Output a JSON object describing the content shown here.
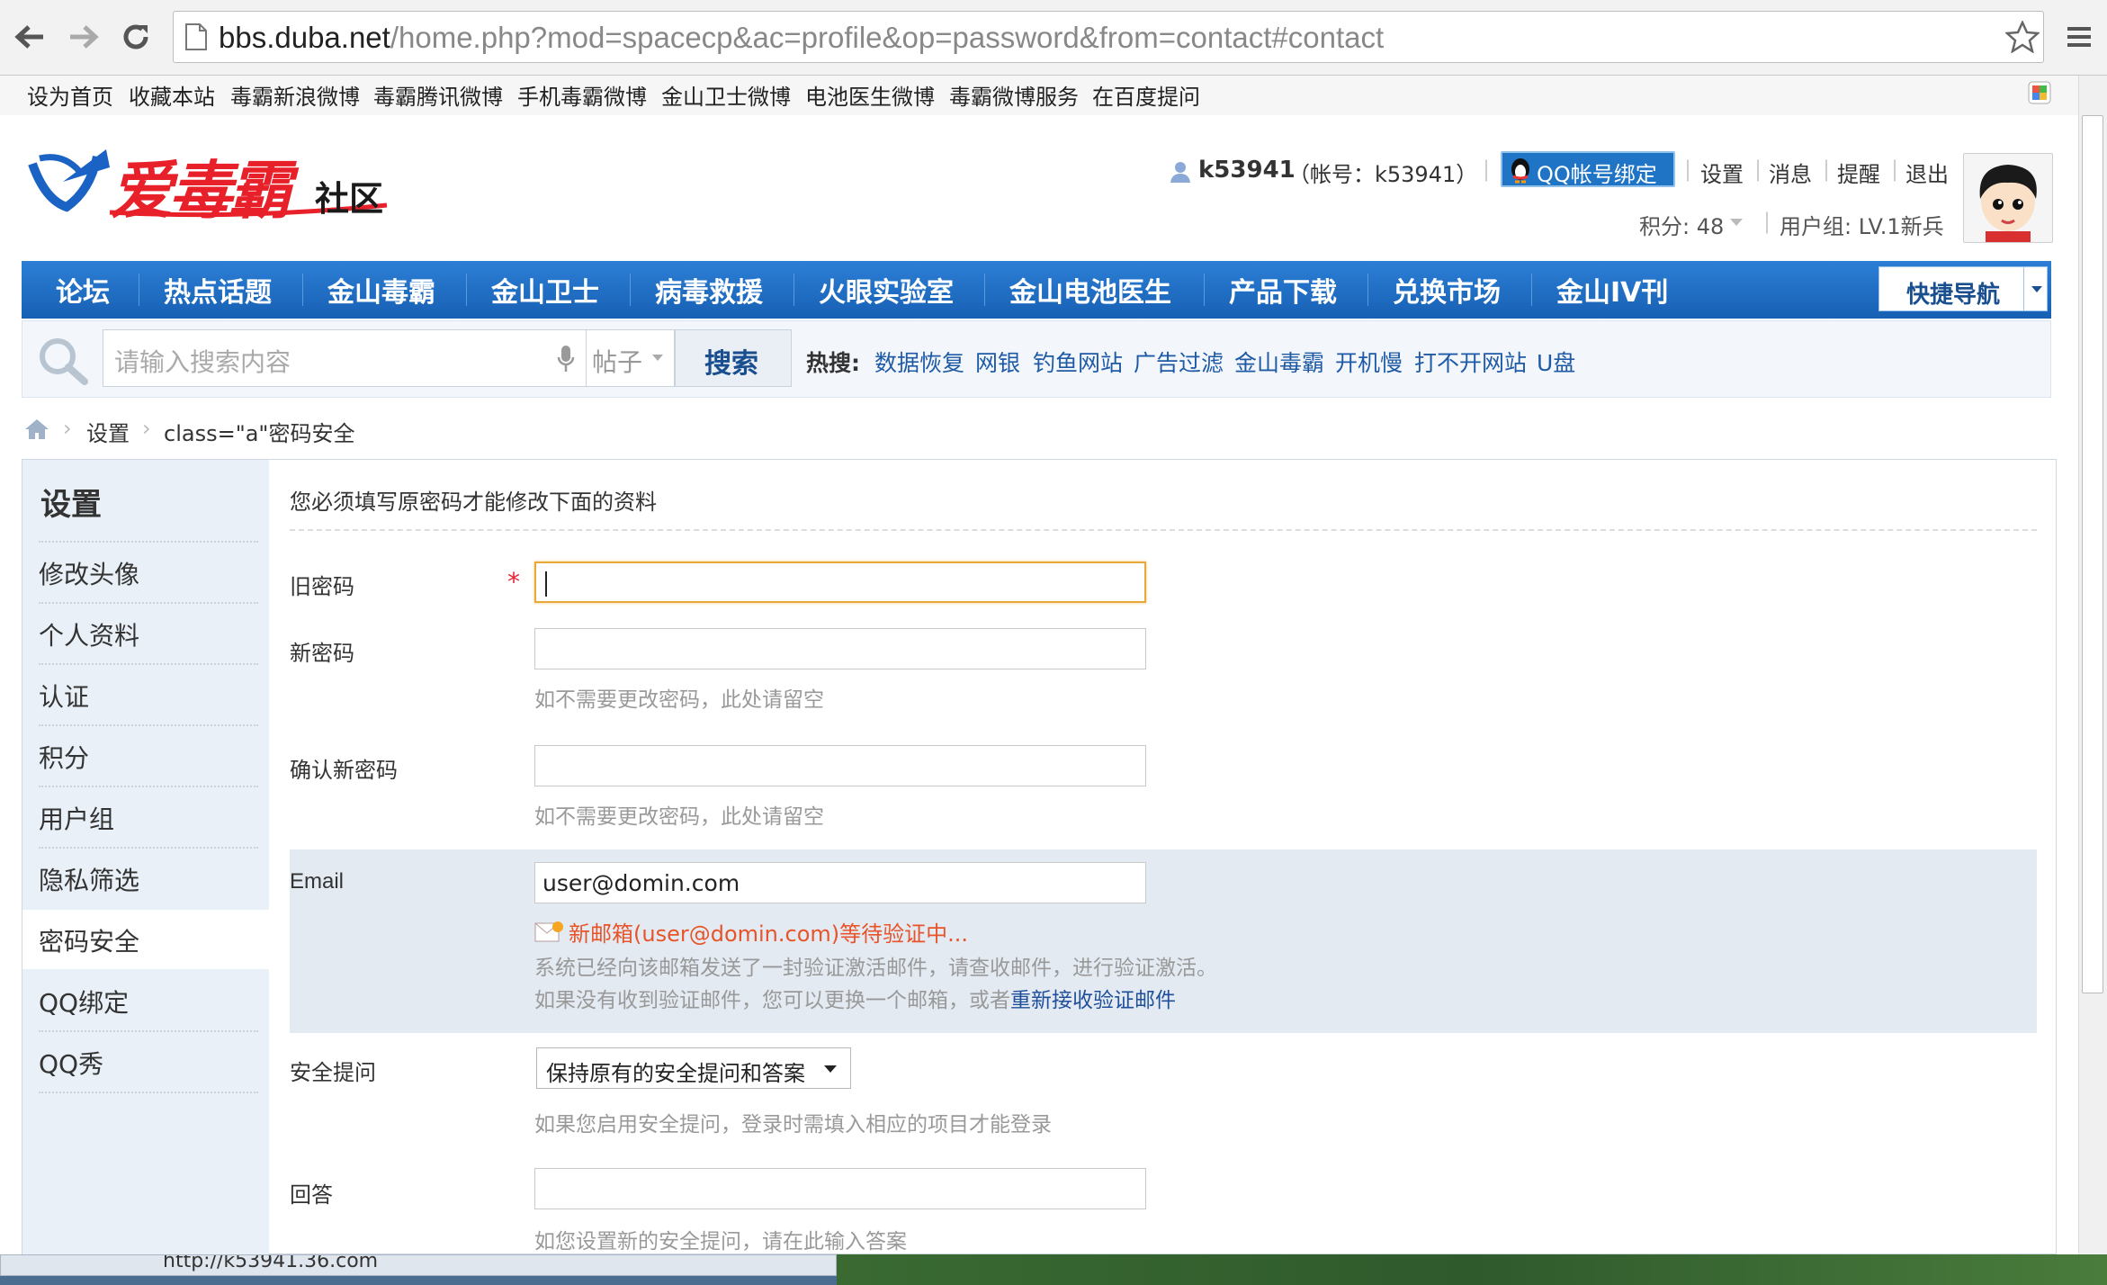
{
  "browser": {
    "url_host": "bbs.duba.net",
    "url_path": "/home.php?mod=spacecp&ac=profile&op=password&from=contact#contact"
  },
  "bookmarks": [
    "设为首页",
    "收藏本站",
    "毒霸新浪微博",
    "毒霸腾讯微博",
    "手机毒霸微博",
    "金山卫士微博",
    "电池医生微博",
    "毒霸微博服务",
    "在百度提问"
  ],
  "logo": {
    "main": "爱毒霸",
    "sub": "社区"
  },
  "user": {
    "name": "k53941",
    "account": "（帐号：k53941）",
    "qq_bind": "QQ帐号绑定",
    "links": [
      "设置",
      "消息",
      "提醒",
      "退出"
    ],
    "points": "积分: 48",
    "group": "用户组: LV.1新兵"
  },
  "nav": {
    "items": [
      "论坛",
      "热点话题",
      "金山毒霸",
      "金山卫士",
      "病毒救援",
      "火眼实验室",
      "金山电池医生",
      "产品下载",
      "兑换市场",
      "金山IV刊"
    ],
    "quick": "快捷导航"
  },
  "search": {
    "placeholder": "请输入搜索内容",
    "type": "帖子",
    "button": "搜索",
    "hot_label": "热搜:",
    "hot": [
      "数据恢复",
      "网银",
      "钓鱼网站",
      "广告过滤",
      "金山毒霸",
      "开机慢",
      "打不开网站",
      "U盘"
    ]
  },
  "breadcrumb": [
    "设置",
    "class=\"a\"密码安全"
  ],
  "sidebar": {
    "title": "设置",
    "items": [
      "修改头像",
      "个人资料",
      "认证",
      "积分",
      "用户组",
      "隐私筛选",
      "密码安全",
      "QQ绑定",
      "QQ秀"
    ]
  },
  "form": {
    "note": "您必须填写原密码才能修改下面的资料",
    "old_password": "旧密码",
    "required": "*",
    "new_password": "新密码",
    "new_hint": "如不需要更改密码，此处请留空",
    "confirm_password": "确认新密码",
    "confirm_hint": "如不需要更改密码，此处请留空",
    "email_label": "Email",
    "email_value": "user@domin.com",
    "email_pending": "新邮箱(user@domin.com)等待验证中...",
    "email_info1": "系统已经向该邮箱发送了一封验证激活邮件，请查收邮件，进行验证激活。",
    "email_info2": "如果没有收到验证邮件，您可以更换一个邮箱，或者",
    "email_resend": "重新接收验证邮件",
    "security_label": "安全提问",
    "security_value": "保持原有的安全提问和答案",
    "security_hint": "如果您启用安全提问，登录时需填入相应的项目才能登录",
    "answer_label": "回答",
    "answer_hint": "如您设置新的安全提问，请在此输入答案"
  },
  "status": "http://k53941.36.com"
}
